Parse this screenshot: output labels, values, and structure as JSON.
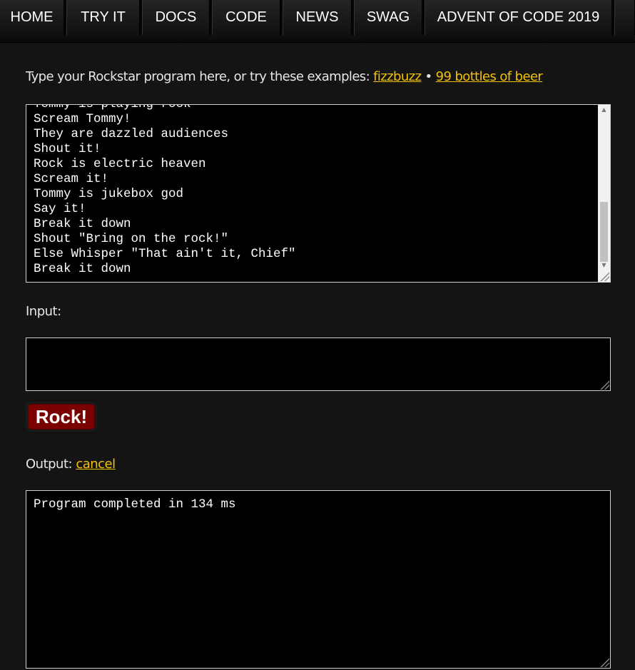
{
  "nav": {
    "items": [
      {
        "label": "HOME"
      },
      {
        "label": "TRY IT"
      },
      {
        "label": "DOCS"
      },
      {
        "label": "CODE"
      },
      {
        "label": "NEWS"
      },
      {
        "label": "SWAG"
      },
      {
        "label": "ADVENT OF CODE 2019"
      }
    ]
  },
  "intro": {
    "text": "Type your Rockstar program here, or try these examples: ",
    "example_1": "fizzbuzz",
    "separator": "•",
    "example_2": "99 bottles of beer"
  },
  "editor": {
    "lines": [
      "Tommy is playing rock",
      "Scream Tommy!",
      "They are dazzled audiences",
      "Shout it!",
      "Rock is electric heaven",
      "Scream it!",
      "Tommy is jukebox god",
      "Say it!",
      "Break it down",
      "Shout \"Bring on the rock!\"",
      "Else Whisper \"That ain't it, Chief\"",
      "Break it down"
    ]
  },
  "input_section": {
    "label": "Input:",
    "value": ""
  },
  "run_button": {
    "label": "Rock!"
  },
  "output_section": {
    "label": "Output: ",
    "cancel_link": "cancel",
    "text": "Program completed in 134 ms"
  },
  "colors": {
    "background": "#141414",
    "link": "#f2c10a",
    "button": "#7a0000"
  }
}
